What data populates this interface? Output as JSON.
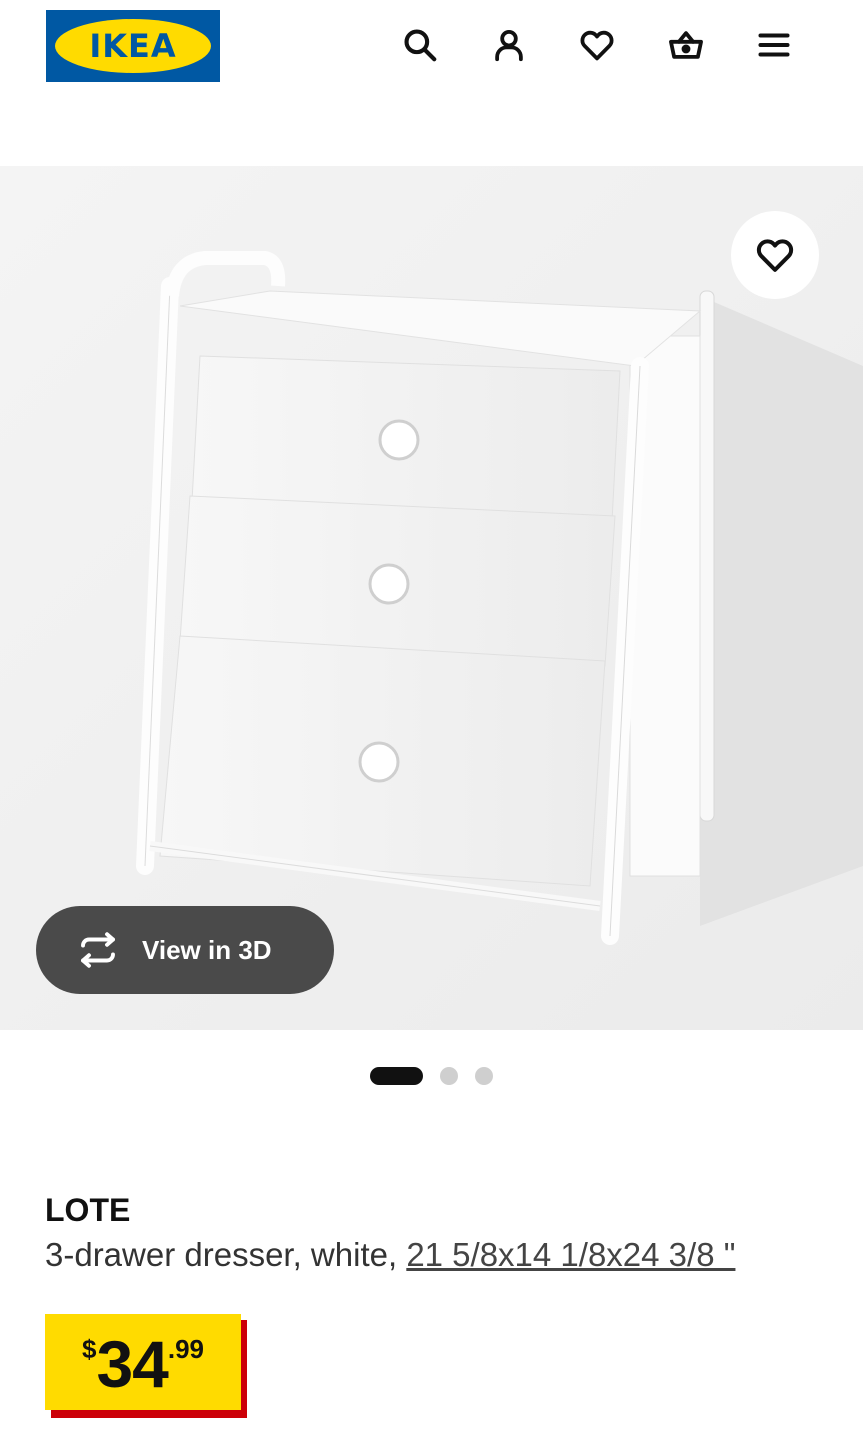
{
  "header": {
    "logo_text": "IKEA",
    "icons": [
      "search-icon",
      "account-icon",
      "heart-icon",
      "basket-icon",
      "menu-icon"
    ]
  },
  "gallery": {
    "view3d_label": "View in 3D",
    "slide_count": 3,
    "active_slide": 1
  },
  "product": {
    "name": "LOTE",
    "description": "3-drawer dresser, white, ",
    "dimensions": "21 5/8x14 1/8x24 3/8 \"",
    "price": {
      "currency": "$",
      "integer": "34",
      "decimal": ".99"
    }
  },
  "colors": {
    "brand_blue": "#0058a3",
    "brand_yellow": "#ffdb00",
    "price_red": "#cc0008",
    "view3d_bg": "#4a4a4a"
  }
}
